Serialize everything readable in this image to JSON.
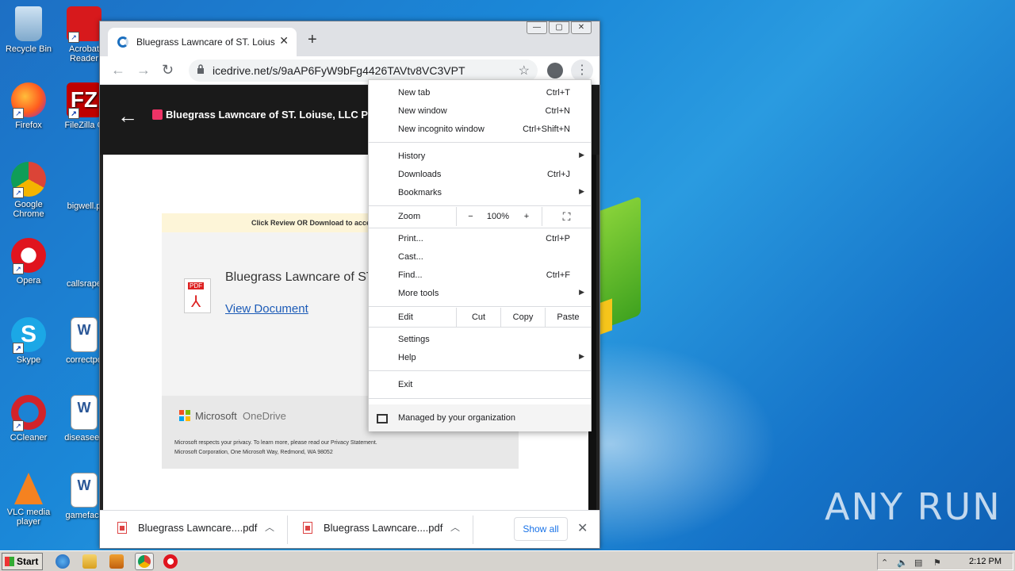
{
  "desktop": {
    "icons": [
      {
        "label": "Recycle Bin"
      },
      {
        "label": "Acrobat Reader"
      },
      {
        "label": "Firefox"
      },
      {
        "label": "FileZilla C"
      },
      {
        "label": "Google Chrome"
      },
      {
        "label": "bigwell.p"
      },
      {
        "label": "Opera"
      },
      {
        "label": "callsrape"
      },
      {
        "label": "Skype"
      },
      {
        "label": "correctpo"
      },
      {
        "label": "CCleaner"
      },
      {
        "label": "diseaseex"
      },
      {
        "label": "VLC media player"
      },
      {
        "label": "gamefacil"
      }
    ],
    "watermark": "ANY RUN"
  },
  "browser": {
    "tab_title": "Bluegrass Lawncare of ST. Loiuse, LLC",
    "tab_close": "✕",
    "new_tab": "+",
    "url": "icedrive.net/s/9aAP6FyW9bFg4426TAVtv8VC3VPT",
    "page": {
      "header_title": "Bluegrass Lawncare of ST. Loiuse, LLC Pr",
      "notice": "Click Review OR Download to access this document",
      "doc_name": "Bluegrass Lawncare of ST. L",
      "view_document": "View Document",
      "pdf_label": "PDF",
      "microsoft": "Microsoft",
      "onedrive": "OneDrive",
      "privacy_line": "Microsoft respects your privacy. To learn more, please read our Privacy Statement.",
      "address_line": "Microsoft Corporation, One Microsoft Way, Redmond, WA 98052"
    },
    "downloads": {
      "items": [
        {
          "name": "Bluegrass Lawncare....pdf"
        },
        {
          "name": "Bluegrass Lawncare....pdf"
        }
      ],
      "show_all": "Show all"
    },
    "menu": {
      "new_tab": {
        "label": "New tab",
        "shortcut": "Ctrl+T"
      },
      "new_window": {
        "label": "New window",
        "shortcut": "Ctrl+N"
      },
      "new_incognito": {
        "label": "New incognito window",
        "shortcut": "Ctrl+Shift+N"
      },
      "history": {
        "label": "History"
      },
      "downloads": {
        "label": "Downloads",
        "shortcut": "Ctrl+J"
      },
      "bookmarks": {
        "label": "Bookmarks"
      },
      "zoom": {
        "label": "Zoom",
        "minus": "−",
        "value": "100%",
        "plus": "+"
      },
      "print": {
        "label": "Print...",
        "shortcut": "Ctrl+P"
      },
      "cast": {
        "label": "Cast..."
      },
      "find": {
        "label": "Find...",
        "shortcut": "Ctrl+F"
      },
      "more_tools": {
        "label": "More tools"
      },
      "edit": {
        "label": "Edit",
        "cut": "Cut",
        "copy": "Copy",
        "paste": "Paste"
      },
      "settings": {
        "label": "Settings"
      },
      "help": {
        "label": "Help"
      },
      "exit": {
        "label": "Exit"
      },
      "managed": {
        "label": "Managed by your organization"
      }
    }
  },
  "taskbar": {
    "start": "Start",
    "clock": "2:12 PM"
  }
}
